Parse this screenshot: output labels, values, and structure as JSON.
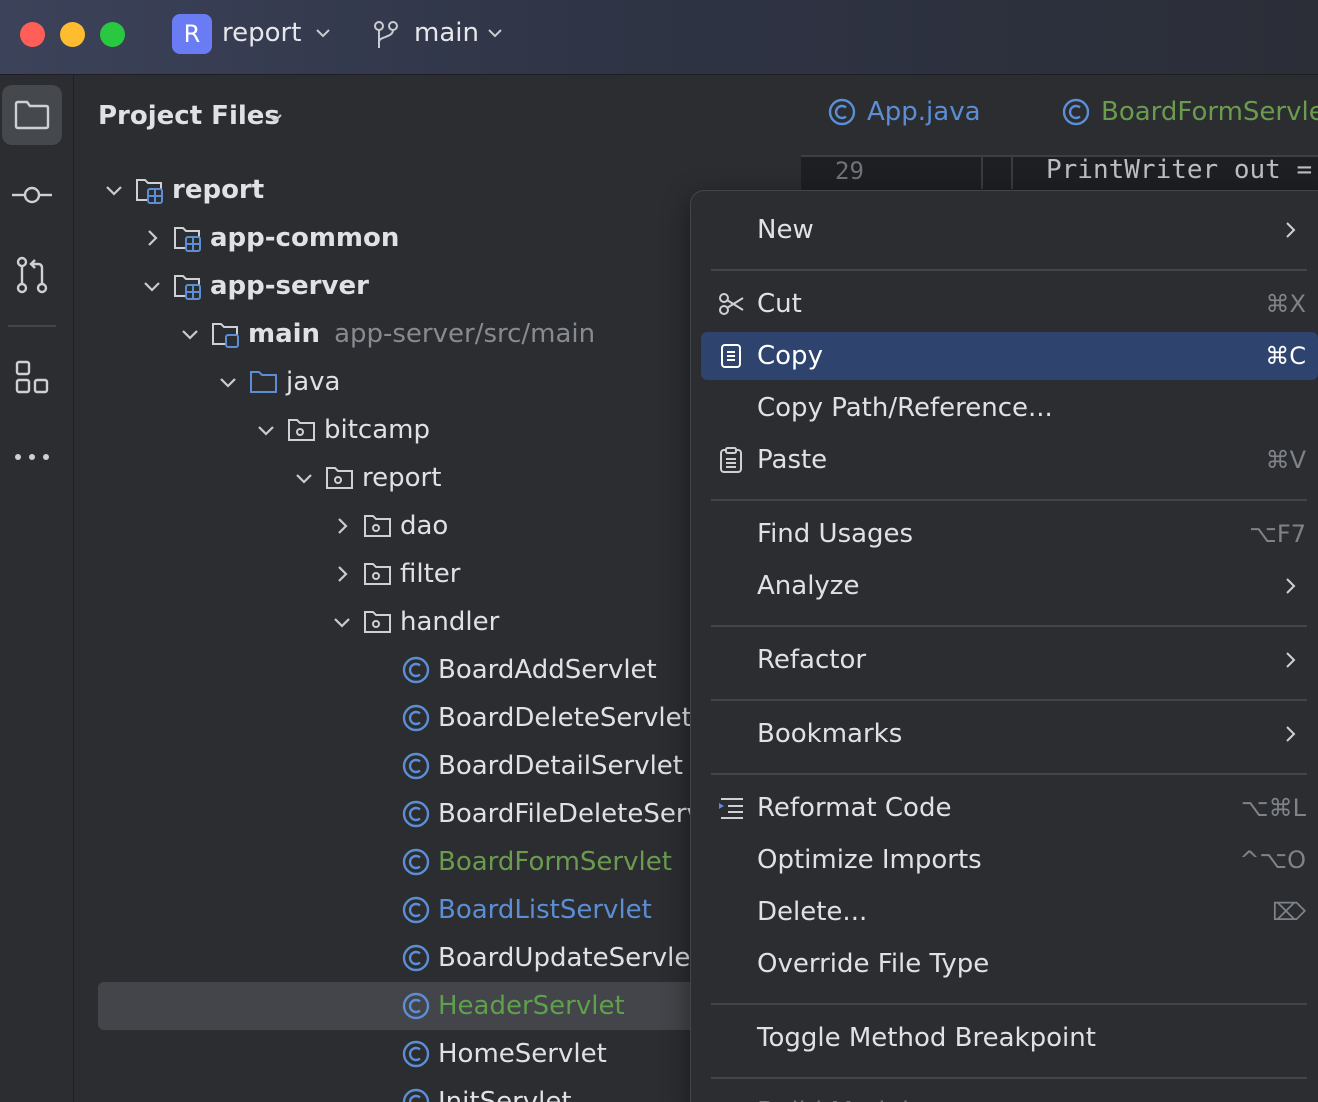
{
  "titlebar": {
    "project_badge": "R",
    "project_name": "report",
    "branch": "main"
  },
  "toolstrip": {
    "icons": [
      "folder-icon",
      "commit-icon",
      "pull-request-icon",
      "structure-icon",
      "more-icon"
    ]
  },
  "panel": {
    "title": "Project Files",
    "tree": [
      {
        "label": "report",
        "style": "bold",
        "icon": "module-folder",
        "expanded": true,
        "level": 0
      },
      {
        "label": "app-common",
        "style": "bold",
        "icon": "module-folder",
        "expanded": false,
        "level": 1
      },
      {
        "label": "app-server",
        "style": "bold",
        "icon": "module-folder",
        "expanded": true,
        "level": 1
      },
      {
        "label": "main",
        "hint": "app-server/src/main",
        "style": "bold",
        "icon": "source-root-folder",
        "expanded": true,
        "level": 2
      },
      {
        "label": "java",
        "style": "normal",
        "icon": "java-folder",
        "expanded": true,
        "level": 3
      },
      {
        "label": "bitcamp",
        "style": "normal",
        "icon": "package-folder",
        "expanded": true,
        "level": 4
      },
      {
        "label": "report",
        "style": "normal",
        "icon": "package-folder",
        "expanded": true,
        "level": 5
      },
      {
        "label": "dao",
        "style": "normal",
        "icon": "package-folder",
        "expanded": false,
        "level": 6
      },
      {
        "label": "filter",
        "style": "normal",
        "icon": "package-folder",
        "expanded": false,
        "level": 6
      },
      {
        "label": "handler",
        "style": "normal",
        "icon": "package-folder",
        "expanded": true,
        "level": 6
      },
      {
        "label": "BoardAddServlet",
        "style": "normal",
        "icon": "class",
        "level": 7
      },
      {
        "label": "BoardDeleteServlet",
        "style": "normal",
        "icon": "class",
        "level": 7
      },
      {
        "label": "BoardDetailServlet",
        "style": "normal",
        "icon": "class",
        "level": 7
      },
      {
        "label": "BoardFileDeleteServ",
        "style": "normal",
        "icon": "class",
        "level": 7
      },
      {
        "label": "BoardFormServlet",
        "style": "green",
        "icon": "class",
        "level": 7
      },
      {
        "label": "BoardListServlet",
        "style": "blue",
        "icon": "class",
        "level": 7
      },
      {
        "label": "BoardUpdateServlet",
        "style": "normal",
        "icon": "class",
        "level": 7
      },
      {
        "label": "HeaderServlet",
        "style": "green2",
        "icon": "class",
        "level": 7,
        "selected": true
      },
      {
        "label": "HomeServlet",
        "style": "normal",
        "icon": "class",
        "level": 7
      },
      {
        "label": "InitServlet",
        "style": "normal",
        "icon": "class",
        "level": 7
      }
    ]
  },
  "editor": {
    "tabs": [
      {
        "label": "App.java",
        "color": "#5b8ed4"
      },
      {
        "label": "BoardFormServlet",
        "color": "#6a9b4f"
      }
    ],
    "line_number": "29",
    "code": "PrintWriter out ="
  },
  "menu": {
    "items": [
      {
        "label": "New",
        "submenu": true
      },
      {
        "sep": true
      },
      {
        "label": "Cut",
        "shortcut": "⌘X",
        "icon": "scissors"
      },
      {
        "label": "Copy",
        "shortcut": "⌘C",
        "icon": "copy",
        "highlighted": true
      },
      {
        "label": "Copy Path/Reference..."
      },
      {
        "label": "Paste",
        "shortcut": "⌘V",
        "icon": "paste"
      },
      {
        "sep": true
      },
      {
        "label": "Find Usages",
        "shortcut": "⌥F7"
      },
      {
        "label": "Analyze",
        "submenu": true
      },
      {
        "sep": true
      },
      {
        "label": "Refactor",
        "submenu": true
      },
      {
        "sep": true
      },
      {
        "label": "Bookmarks",
        "submenu": true
      },
      {
        "sep": true
      },
      {
        "label": "Reformat Code",
        "shortcut": "⌥⌘L",
        "icon": "reformat"
      },
      {
        "label": "Optimize Imports",
        "shortcut": "^⌥O"
      },
      {
        "label": "Delete...",
        "shortcut": "⌦"
      },
      {
        "label": "Override File Type"
      },
      {
        "sep": true
      },
      {
        "label": "Toggle Method Breakpoint"
      },
      {
        "sep": true
      },
      {
        "label": "Build Module",
        "disabled": true
      }
    ]
  }
}
